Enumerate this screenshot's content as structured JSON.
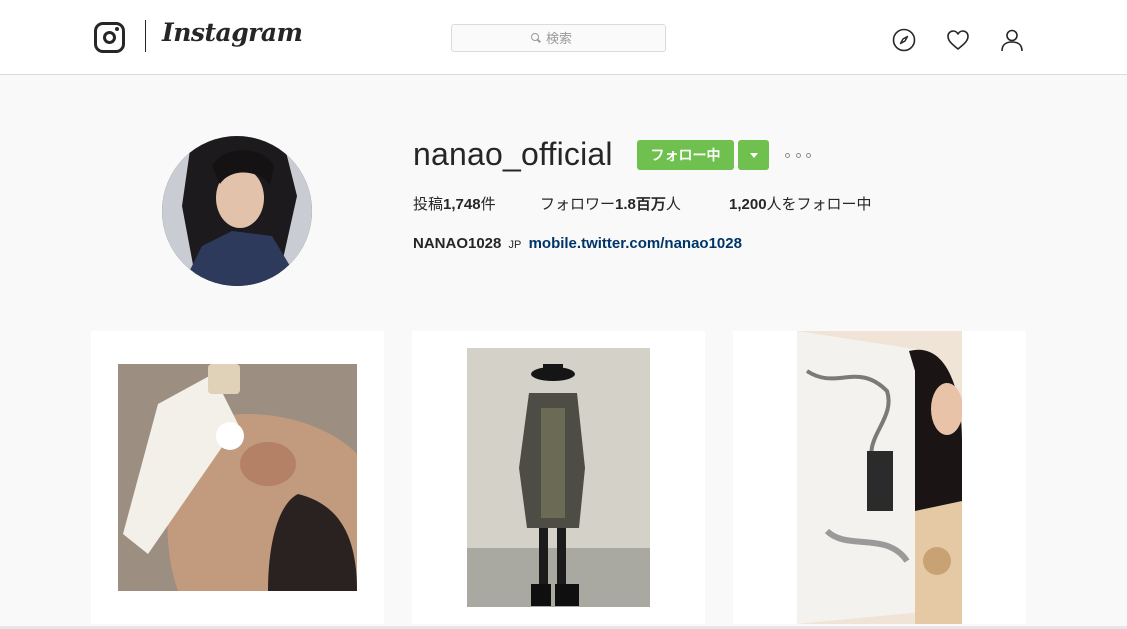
{
  "header": {
    "wordmark": "Instagram",
    "search_placeholder": "検索",
    "icons": [
      "instagram-camera-icon",
      "compass-icon",
      "heart-icon",
      "person-icon"
    ]
  },
  "profile": {
    "username": "nanao_official",
    "follow_button": "フォロー中",
    "stats": {
      "posts_prefix": "投稿",
      "posts_value": "1,748",
      "posts_suffix": "件",
      "followers_prefix": "フォロワー",
      "followers_value": "1.8百万",
      "followers_suffix": "人",
      "following_value": "1,200",
      "following_suffix": "人をフォロー中"
    },
    "bio": {
      "full_name": "NANAO1028",
      "tag": "JP",
      "link": "mobile.twitter.com/nanao1028"
    }
  },
  "posts": [
    {
      "kind": "photo"
    },
    {
      "kind": "photo"
    },
    {
      "kind": "video",
      "icon": "video-camera-icon"
    }
  ],
  "colors": {
    "follow_green": "#70c050",
    "link_blue": "#003569",
    "background": "#f9f9f9"
  }
}
